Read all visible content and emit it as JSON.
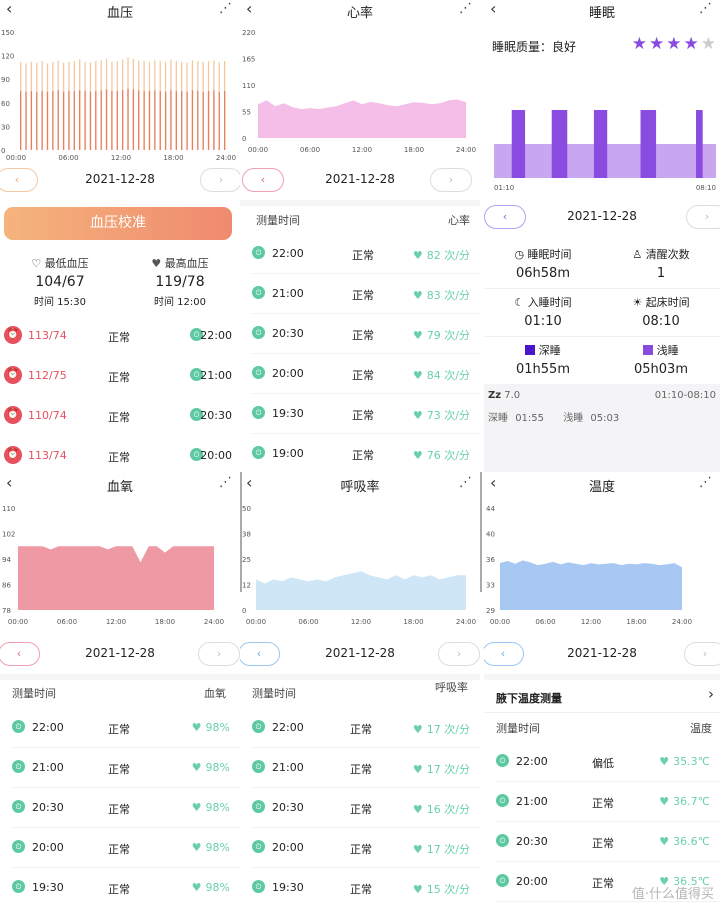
{
  "colors": {
    "bp": "#f0b080",
    "hr": "#f0b0e0",
    "sleep_deep": "#8a4ce0",
    "sleep_light": "#c8a6f0",
    "spo2": "#ec8e9a",
    "resp": "#cfe6f7",
    "temp": "#9ec4f2",
    "accent_green": "#5cc9a0"
  },
  "bp": {
    "title": "血压",
    "date": "2021-12-28",
    "calib_button": "血压校准",
    "min_label": "最低血压",
    "min_value": "104/67",
    "min_time": "时间 15:30",
    "max_label": "最高血压",
    "max_value": "119/78",
    "max_time": "时间 12:00",
    "rows": [
      {
        "value": "113/74",
        "status": "正常",
        "time": "22:00"
      },
      {
        "value": "112/75",
        "status": "正常",
        "time": "21:00"
      },
      {
        "value": "110/74",
        "status": "正常",
        "time": "20:30"
      },
      {
        "value": "113/74",
        "status": "正常",
        "time": "20:00"
      }
    ],
    "chart_data": {
      "type": "bar",
      "title": "",
      "xlabel": "",
      "ylabel": "",
      "yticks": [
        "0",
        "30",
        "60",
        "90",
        "120",
        "150"
      ],
      "xticks": [
        "00:00",
        "06:00",
        "12:00",
        "18:00",
        "24:00"
      ],
      "ylim": [
        0,
        150
      ],
      "series": [
        {
          "name": "",
          "values": [
            112,
            110,
            112,
            111,
            113,
            110,
            112,
            114,
            111,
            112,
            113,
            115,
            112,
            111,
            113,
            114,
            116,
            112,
            113,
            115,
            118,
            116,
            114,
            113,
            112,
            114,
            113,
            112,
            115,
            113,
            112,
            111,
            114,
            113,
            112,
            113,
            114,
            112,
            113
          ]
        },
        {
          "name": "",
          "values": [
            75,
            74,
            75,
            74,
            75,
            74,
            75,
            76,
            74,
            75,
            75,
            76,
            75,
            74,
            75,
            76,
            77,
            75,
            75,
            76,
            78,
            77,
            76,
            75,
            75,
            76,
            75,
            74,
            76,
            75,
            75,
            74,
            76,
            75,
            74,
            75,
            76,
            74,
            75
          ]
        }
      ]
    }
  },
  "hr": {
    "title": "心率",
    "date": "2021-12-28",
    "list_col1": "测量时间",
    "list_col2": "心率",
    "rows": [
      {
        "time": "22:00",
        "status": "正常",
        "value": "82 次/分"
      },
      {
        "time": "21:00",
        "status": "正常",
        "value": "83 次/分"
      },
      {
        "time": "20:30",
        "status": "正常",
        "value": "79 次/分"
      },
      {
        "time": "20:00",
        "status": "正常",
        "value": "84 次/分"
      },
      {
        "time": "19:30",
        "status": "正常",
        "value": "73 次/分"
      },
      {
        "time": "19:00",
        "status": "正常",
        "value": "76 次/分"
      }
    ],
    "chart_data": {
      "type": "area",
      "title": "",
      "xlabel": "",
      "ylabel": "",
      "yticks": [
        "0",
        "55",
        "110",
        "165",
        "220"
      ],
      "xticks": [
        "00:00",
        "06:00",
        "12:00",
        "18:00",
        "24:00"
      ],
      "ylim": [
        0,
        220
      ],
      "x": [
        0,
        1,
        2,
        3,
        4,
        5,
        6,
        7,
        8,
        9,
        10,
        11,
        12,
        13,
        14,
        15,
        16,
        17,
        18,
        19,
        20,
        21,
        22,
        23,
        24
      ],
      "values": [
        70,
        78,
        66,
        72,
        64,
        60,
        62,
        60,
        63,
        66,
        72,
        78,
        70,
        75,
        72,
        68,
        66,
        70,
        74,
        73,
        70,
        72,
        78,
        80,
        74
      ]
    }
  },
  "sleep": {
    "title": "睡眠",
    "quality_label": "睡眠质量：良好",
    "stars": 4,
    "stars_total": 5,
    "date": "2021-12-28",
    "chart_start": "01:10",
    "chart_end": "08:10",
    "sleep_time_label": "睡眠时间",
    "sleep_time": "06h58m",
    "wake_count_label": "清醒次数",
    "wake_count": "1",
    "sleep_start_label": "入睡时间",
    "sleep_start": "01:10",
    "wake_time_label": "起床时间",
    "wake_time": "08:10",
    "deep_label": "深睡",
    "deep_value": "01h55m",
    "light_label": "浅睡",
    "light_value": "05h03m",
    "zz_label": "7.0",
    "range": "01:10-08:10",
    "bottom_deep_label": "深睡",
    "bottom_deep": "01:55",
    "bottom_light_label": "浅睡",
    "bottom_light": "05:03",
    "chart_data": {
      "type": "bar",
      "title": "",
      "xticks": [
        "01:10",
        "08:10"
      ],
      "deep_segments": [
        [
          0.08,
          0.14
        ],
        [
          0.26,
          0.33
        ],
        [
          0.45,
          0.51
        ],
        [
          0.66,
          0.73
        ],
        [
          0.91,
          0.94
        ]
      ]
    }
  },
  "spo2": {
    "title": "血氧",
    "date": "2021-12-28",
    "list_col1": "测量时间",
    "list_col2": "血氧",
    "rows": [
      {
        "time": "22:00",
        "status": "正常",
        "value": "98%"
      },
      {
        "time": "21:00",
        "status": "正常",
        "value": "98%"
      },
      {
        "time": "20:30",
        "status": "正常",
        "value": "98%"
      },
      {
        "time": "20:00",
        "status": "正常",
        "value": "98%"
      },
      {
        "time": "19:30",
        "status": "正常",
        "value": "98%"
      }
    ],
    "chart_data": {
      "type": "area",
      "title": "",
      "yticks": [
        "78",
        "86",
        "94",
        "102",
        "110"
      ],
      "xticks": [
        "00:00",
        "06:00",
        "12:00",
        "18:00",
        "24:00"
      ],
      "ylim": [
        78,
        110
      ],
      "x": [
        0,
        1,
        2,
        3,
        4,
        5,
        6,
        7,
        8,
        9,
        10,
        11,
        12,
        13,
        14,
        15,
        16,
        17,
        18,
        19,
        20,
        21,
        22,
        23,
        24
      ],
      "values": [
        98,
        98,
        98,
        98,
        97,
        98,
        98,
        98,
        98,
        98,
        98,
        97,
        98,
        98,
        98,
        93,
        98,
        98,
        96,
        98,
        98,
        98,
        98,
        98,
        98
      ]
    }
  },
  "resp": {
    "title": "呼吸率",
    "date": "2021-12-28",
    "list_col1": "测量时间",
    "list_col2": "呼吸率",
    "rows": [
      {
        "time": "22:00",
        "status": "正常",
        "value": "17 次/分"
      },
      {
        "time": "21:00",
        "status": "正常",
        "value": "17 次/分"
      },
      {
        "time": "20:30",
        "status": "正常",
        "value": "16 次/分"
      },
      {
        "time": "20:00",
        "status": "正常",
        "value": "17 次/分"
      },
      {
        "time": "19:30",
        "status": "正常",
        "value": "15 次/分"
      }
    ],
    "chart_data": {
      "type": "area",
      "title": "",
      "yticks": [
        "0",
        "12",
        "25",
        "38",
        "50"
      ],
      "xticks": [
        "00:00",
        "06:00",
        "12:00",
        "18:00",
        "24:00"
      ],
      "ylim": [
        0,
        50
      ],
      "x": [
        0,
        1,
        2,
        3,
        4,
        5,
        6,
        7,
        8,
        9,
        10,
        11,
        12,
        13,
        14,
        15,
        16,
        17,
        18,
        19,
        20,
        21,
        22,
        23,
        24
      ],
      "values": [
        15,
        13,
        15,
        14,
        16,
        15,
        14,
        15,
        14,
        16,
        17,
        18,
        19,
        17,
        16,
        15,
        17,
        15,
        17,
        16,
        17,
        15,
        16,
        17,
        17
      ]
    }
  },
  "temp": {
    "title": "温度",
    "date": "2021-12-28",
    "section_title": "腋下温度测量",
    "list_col1": "测量时间",
    "list_col2": "温度",
    "rows": [
      {
        "time": "22:00",
        "status": "偏低",
        "value": "35.3℃"
      },
      {
        "time": "21:00",
        "status": "正常",
        "value": "36.7℃"
      },
      {
        "time": "20:30",
        "status": "正常",
        "value": "36.6℃"
      },
      {
        "time": "20:00",
        "status": "正常",
        "value": "36.5℃"
      }
    ],
    "chart_data": {
      "type": "area",
      "title": "",
      "yticks": [
        "29",
        "33",
        "36",
        "40",
        "44"
      ],
      "xticks": [
        "00:00",
        "06:00",
        "12:00",
        "18:00",
        "24:00"
      ],
      "ylim": [
        29,
        44
      ],
      "x": [
        0,
        1,
        2,
        3,
        4,
        5,
        6,
        7,
        8,
        9,
        10,
        11,
        12,
        13,
        14,
        15,
        16,
        17,
        18,
        19,
        20,
        21,
        22,
        23,
        24
      ],
      "values": [
        35.9,
        36.2,
        35.8,
        36.3,
        36.0,
        35.6,
        35.8,
        36.1,
        35.7,
        36.0,
        35.8,
        35.6,
        35.9,
        35.7,
        35.8,
        35.9,
        35.6,
        35.8,
        35.7,
        35.9,
        35.8,
        35.6,
        35.7,
        35.9,
        35.3
      ]
    }
  },
  "watermark": "值·什么值得买"
}
